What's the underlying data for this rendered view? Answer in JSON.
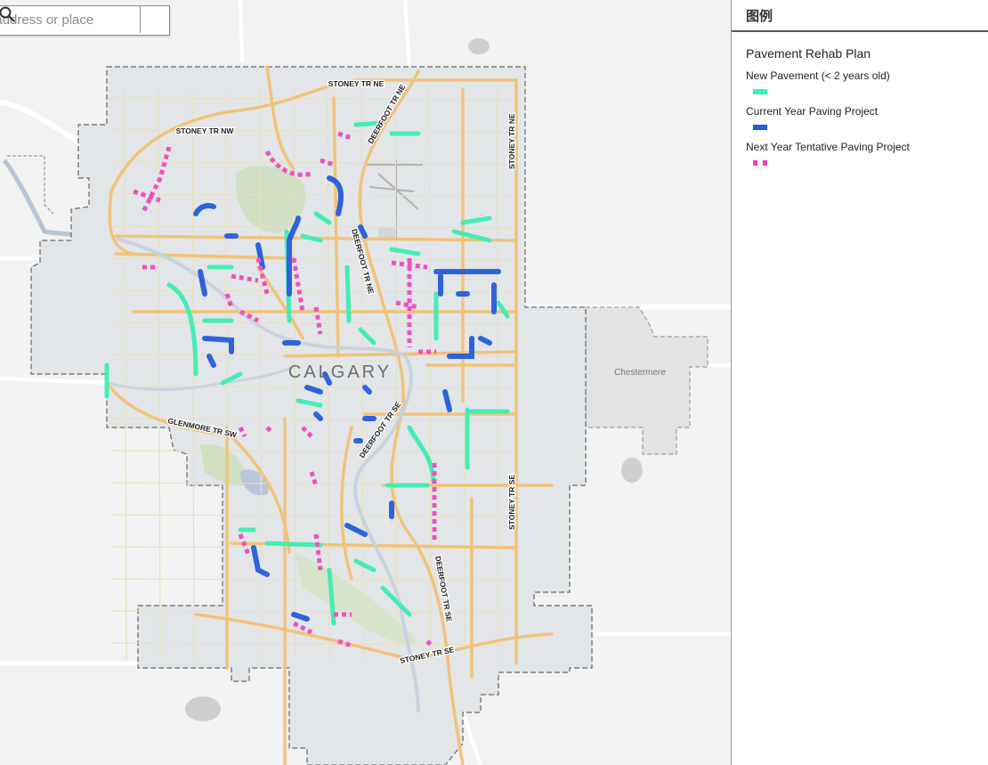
{
  "search": {
    "placeholder": "Find address or place"
  },
  "legend": {
    "header": "图例",
    "layer_title": "Pavement Rehab Plan",
    "items": [
      {
        "label": "New Pavement (< 2 years old)",
        "color": "#3ef0b4"
      },
      {
        "label": "Current Year Paving Project",
        "color": "#1d5fe0"
      },
      {
        "label": "Next Year Tentative Paving Project",
        "color": "#ef3cbd"
      }
    ]
  },
  "map": {
    "city_label": "CALGARY",
    "neighbor_label": "Chestermere",
    "road_labels": {
      "stoney_ne": "STONEY TR NE",
      "stoney_nw": "STONEY TR NW",
      "stoney_e": "STONEY TR NE",
      "stoney_se": "STONEY TR SE",
      "stoney_se_bottom": "STONEY TR SE",
      "deerfoot_ne_top": "DEERFOOT TR NE",
      "deerfoot_ne_mid": "DEERFOOT TR NE",
      "deerfoot_se_mid": "DEERFOOT TR SE",
      "deerfoot_se_low": "DEERFOOT TR SE",
      "glenmore": "GLENMORE TR SW"
    }
  }
}
